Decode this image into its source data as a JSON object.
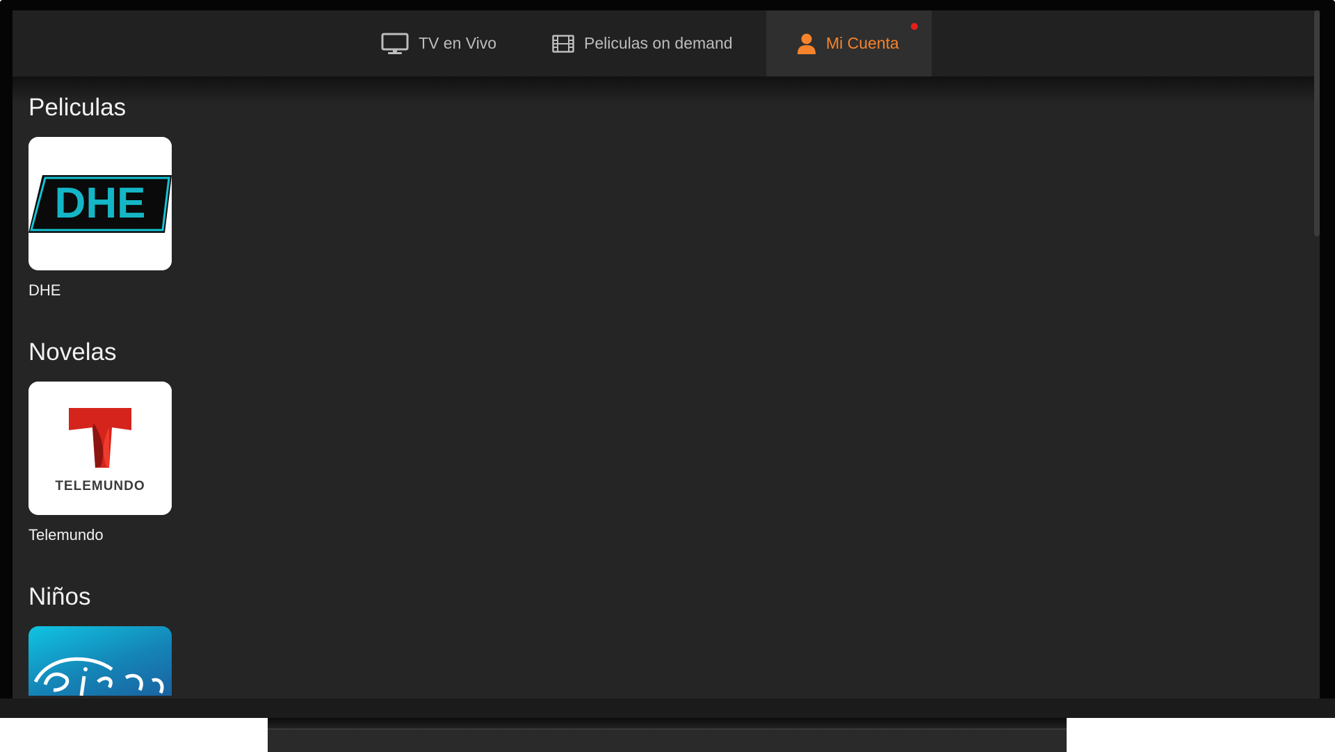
{
  "nav": {
    "tabs": [
      {
        "label": "TV en Vivo",
        "icon": "tv-icon",
        "active": false
      },
      {
        "label": "Peliculas on demand",
        "icon": "film-icon",
        "active": false
      },
      {
        "label": "Mi Cuenta",
        "icon": "user-icon",
        "active": true,
        "badge": true
      }
    ]
  },
  "colors": {
    "accent": "#f7842c",
    "badge": "#e52019",
    "background": "#252525",
    "nav_background": "#212121"
  },
  "sections": [
    {
      "title": "Peliculas",
      "items": [
        {
          "label": "DHE",
          "logo_text": "DHE",
          "logo": "dhe-logo"
        }
      ]
    },
    {
      "title": "Novelas",
      "items": [
        {
          "label": "Telemundo",
          "logo_text": "TELEMUNDO",
          "logo": "telemundo-logo"
        }
      ]
    },
    {
      "title": "Niños",
      "items": [
        {
          "label": "",
          "logo": "disney-logo"
        }
      ]
    }
  ]
}
